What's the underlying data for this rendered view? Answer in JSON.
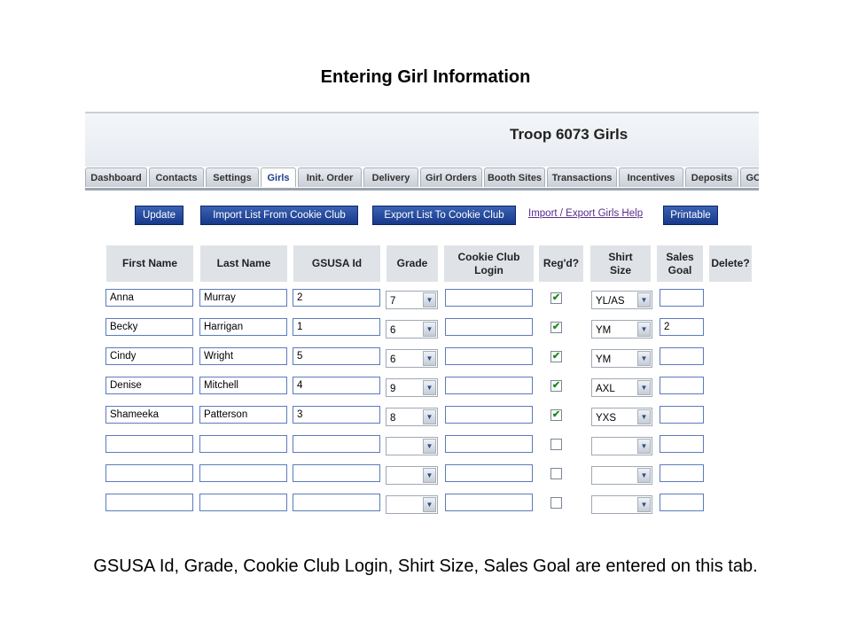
{
  "slide_title": "Entering Girl Information",
  "caption": "GSUSA Id, Grade, Cookie Club Login, Shirt Size, Sales Goal are entered on this tab.",
  "troop_title": "Troop 6073 Girls",
  "tabs": [
    "Dashboard",
    "Contacts",
    "Settings",
    "Girls",
    "Init. Order",
    "Delivery",
    "Girl Orders",
    "Booth Sites",
    "Transactions",
    "Incentives",
    "Deposits",
    "GO"
  ],
  "active_tab": "Girls",
  "buttons": {
    "update": "Update",
    "import_list": "Import List From Cookie Club",
    "export_list": "Export List To Cookie Club",
    "printable": "Printable"
  },
  "help_link": "Import / Export Girls Help",
  "columns": [
    "First Name",
    "Last Name",
    "GSUSA Id",
    "Grade",
    "Cookie Club\nLogin",
    "Reg'd?",
    "Shirt\nSize",
    "Sales\nGoal",
    "Delete?"
  ],
  "rows": [
    {
      "first": "Anna",
      "last": "Murray",
      "gsusa_id": "2",
      "grade": "7",
      "login": "",
      "regd": true,
      "shirt": "YL/AS",
      "goal": ""
    },
    {
      "first": "Becky",
      "last": "Harrigan",
      "gsusa_id": "1",
      "grade": "6",
      "login": "",
      "regd": true,
      "shirt": "YM",
      "goal": "2"
    },
    {
      "first": "Cindy",
      "last": "Wright",
      "gsusa_id": "5",
      "grade": "6",
      "login": "",
      "regd": true,
      "shirt": "YM",
      "goal": ""
    },
    {
      "first": "Denise",
      "last": "Mitchell",
      "gsusa_id": "4",
      "grade": "9",
      "login": "",
      "regd": true,
      "shirt": "AXL",
      "goal": ""
    },
    {
      "first": "Shameeka",
      "last": "Patterson",
      "gsusa_id": "3",
      "grade": "8",
      "login": "",
      "regd": true,
      "shirt": "YXS",
      "goal": ""
    },
    {
      "first": "",
      "last": "",
      "gsusa_id": "",
      "grade": "",
      "login": "",
      "regd": false,
      "shirt": "",
      "goal": ""
    },
    {
      "first": "",
      "last": "",
      "gsusa_id": "",
      "grade": "",
      "login": "",
      "regd": false,
      "shirt": "",
      "goal": ""
    },
    {
      "first": "",
      "last": "",
      "gsusa_id": "",
      "grade": "",
      "login": "",
      "regd": false,
      "shirt": "",
      "goal": ""
    }
  ]
}
